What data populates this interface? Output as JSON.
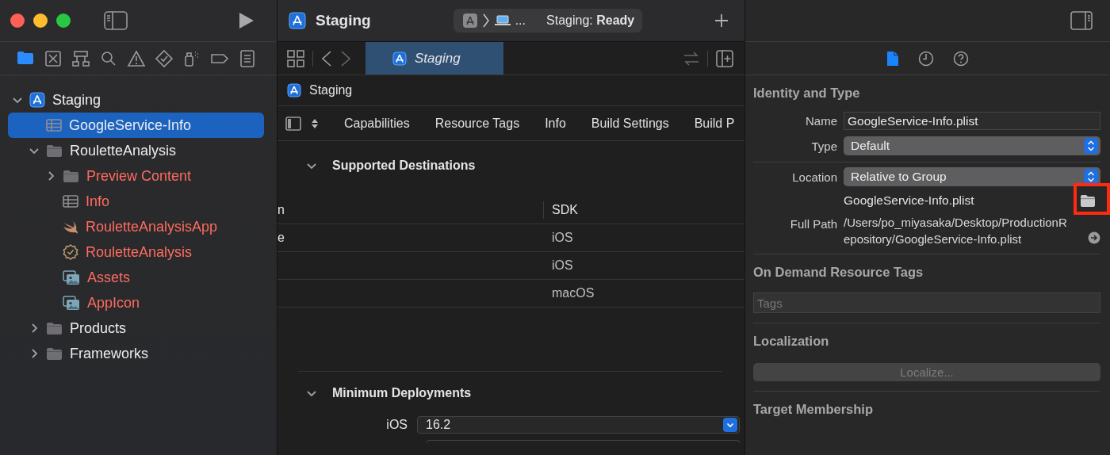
{
  "navigator": {
    "tree": [
      {
        "label": "Staging",
        "kind": "project",
        "missing": false,
        "expanded": true,
        "selected": false,
        "children": [
          {
            "label": "GoogleService-Info",
            "kind": "plist",
            "missing": false,
            "selected": true
          },
          {
            "label": "RouletteAnalysis",
            "kind": "folder",
            "missing": false,
            "expanded": true,
            "selected": false,
            "children": [
              {
                "label": "Preview Content",
                "kind": "folder",
                "missing": true,
                "expanded": false,
                "selected": false
              },
              {
                "label": "Info",
                "kind": "plist",
                "missing": true,
                "selected": false
              },
              {
                "label": "RouletteAnalysisApp",
                "kind": "swift",
                "missing": true,
                "selected": false
              },
              {
                "label": "RouletteAnalysis",
                "kind": "entitlements",
                "missing": true,
                "selected": false
              },
              {
                "label": "Assets",
                "kind": "assets",
                "missing": true,
                "selected": false
              },
              {
                "label": "AppIcon",
                "kind": "assets",
                "missing": true,
                "selected": false
              }
            ]
          },
          {
            "label": "Products",
            "kind": "folder",
            "missing": false,
            "expanded": false,
            "selected": false
          },
          {
            "label": "Frameworks",
            "kind": "folder",
            "missing": false,
            "expanded": false,
            "selected": false
          }
        ]
      }
    ]
  },
  "editor": {
    "title": "Staging",
    "scheme": {
      "ellipsis": "...",
      "status": "Staging: **Ready**"
    },
    "tabs": [
      {
        "label": "Staging",
        "selected": true
      }
    ],
    "jump_bar": "Staging",
    "section_tabs": [
      {
        "label": "Capabilities",
        "selected": false
      },
      {
        "label": "Resource Tags",
        "selected": false
      },
      {
        "label": "Info",
        "selected": false
      },
      {
        "label": "Build Settings",
        "selected": false
      },
      {
        "label": "Build P",
        "selected": false
      }
    ],
    "supported_destinations": {
      "title": "Supported Destinations",
      "expanded": true,
      "columns": [
        "n",
        "SDK"
      ],
      "rows": [
        {
          "column_1": "e",
          "sdk": "iOS"
        },
        {
          "sdk": "iOS"
        },
        {
          "sdk": "macOS"
        }
      ]
    },
    "minimum_deployments": {
      "title": "Minimum Deployments",
      "expanded": true,
      "rows": [
        {
          "label": "iOS",
          "value": "16.2"
        }
      ]
    }
  },
  "inspector": {
    "tabs": [
      {
        "kind": "file",
        "selected": true
      },
      {
        "kind": "history",
        "selected": false
      },
      {
        "kind": "help",
        "selected": false
      }
    ],
    "identity": {
      "title": "Identity and Type",
      "name_label": "Name",
      "name": "GoogleService-Info.plist",
      "type_label": "Type",
      "type": "Default",
      "location_label": "Location",
      "location": "Relative to Group",
      "file_name": "GoogleService-Info.plist",
      "folder_highlighted": true,
      "full_path_label": "Full Path",
      "full_path": "/Users/po_miyasaka/Desktop/ProductionRepository/GoogleService-Info.plist"
    },
    "resource_tags": {
      "title": "On Demand Resource Tags",
      "placeholder": "Tags"
    },
    "localization": {
      "title": "Localization",
      "button": "Localize...",
      "disabled": true
    },
    "target_membership": {
      "title": "Target Membership"
    }
  }
}
